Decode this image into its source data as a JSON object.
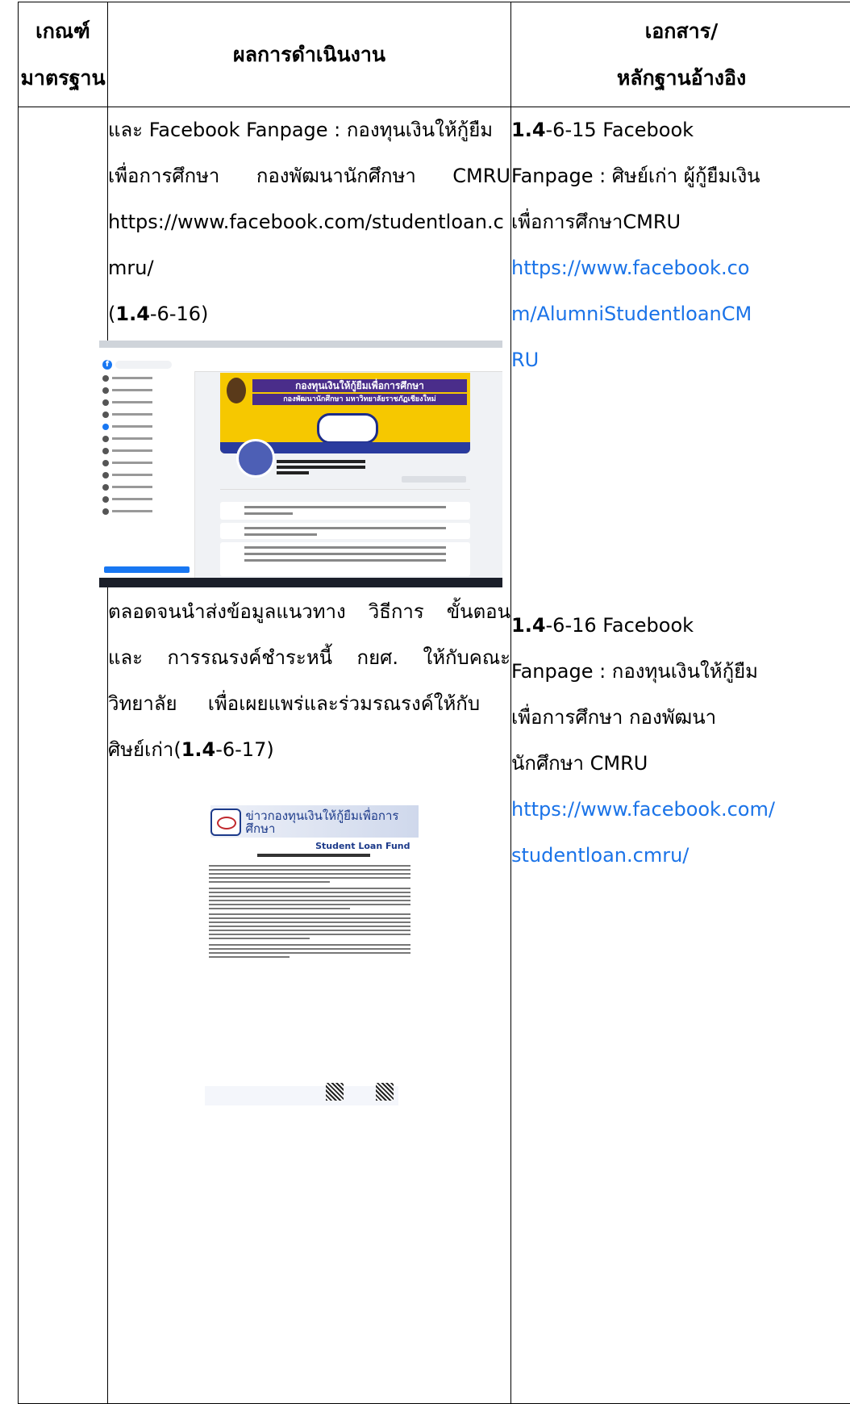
{
  "header": {
    "col1_line1": "เกณฑ์",
    "col1_line2": "มาตรฐาน",
    "col2": "ผลการดำเนินงาน",
    "col3_line1": "เอกสาร/",
    "col3_line2": "หลักฐานอ้างอิง"
  },
  "results": {
    "line1": " และ Facebook Fanpage : กองทุนเงินให้กู้ยืม",
    "line2": "เพื่อการศึกษา กองพัฒนานักศึกษา CMRU",
    "line3": "https://www.facebook.com/studentloan.c",
    "line4": "mru/",
    "ref1_open": "(",
    "ref1_bold": "1.4",
    "ref1_rest": "-6-16)",
    "para2_line1": "ตลอดจนนำส่งข้อมูลแนวทาง วิธีการ ขั้นตอน",
    "para2_line2": "และ การรณรงค์ชำระหนี้ กยศ. ให้กับคณะ",
    "para2_line3": "วิทยาลัย     เพื่อเผยแพร่และร่วมรณรงค์ให้กับ",
    "para2_line4_pre": "ศิษย์เก่า(",
    "para2_line4_bold": "1.4",
    "para2_line4_post": "-6-17)"
  },
  "fb_screenshot": {
    "cover_title1": "กองทุนเงินให้กู้ยืมเพื่อการศึกษา",
    "cover_title2": "กองพัฒนานักศึกษา มหาวิทยาลัยราชภัฏเชียงใหม่",
    "logo_letter": "f"
  },
  "news_doc": {
    "title": "ข่าวกองทุนเงินให้กู้ยืมเพื่อการศึกษา",
    "subtitle": "Student Loan Fund"
  },
  "references": {
    "ref15_bold": "1.4",
    "ref15_line1": "-6-15 Facebook",
    "ref15_line2": "Fanpage : ศิษย์เก่า ผู้กู้ยืมเงิน",
    "ref15_line3": "เพื่อการศึกษาCMRU",
    "ref15_url1": "https://www.facebook.co",
    "ref15_url2": "m/AlumniStudentloanCM",
    "ref15_url3": "RU",
    "ref16_bold": "1.4",
    "ref16_line1": "-6-16 Facebook",
    "ref16_line2": "Fanpage : กองทุนเงินให้กู้ยืม",
    "ref16_line3": "เพื่อการศึกษา กองพัฒนา",
    "ref16_line4": "นักศึกษา CMRU",
    "ref16_url1": "https://www.facebook.com/",
    "ref16_url2": "studentloan.cmru/"
  },
  "colors": {
    "link": "#1a73e8"
  }
}
